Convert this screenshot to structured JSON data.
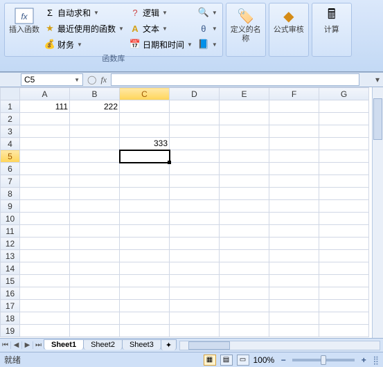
{
  "ribbon": {
    "group1_label": "函数库",
    "insert_fn": "插入函数",
    "autosum": "自动求和",
    "recent": "最近使用的函数",
    "financial": "财务",
    "logical": "逻辑",
    "text": "文本",
    "datetime": "日期和时间",
    "define_name": "定义的名称",
    "formula_audit": "公式审核",
    "calculate": "计算"
  },
  "namebox": "C5",
  "columns": [
    "A",
    "B",
    "C",
    "D",
    "E",
    "F",
    "G"
  ],
  "rows": [
    "1",
    "2",
    "3",
    "4",
    "5",
    "6",
    "7",
    "8",
    "9",
    "10",
    "11",
    "12",
    "13",
    "14",
    "15",
    "16",
    "17",
    "18",
    "19"
  ],
  "cells": {
    "A1": "111",
    "B1": "222",
    "C4": "333"
  },
  "active_cell": {
    "row": 5,
    "col": "C"
  },
  "sheets": [
    "Sheet1",
    "Sheet2",
    "Sheet3"
  ],
  "active_sheet": 0,
  "status_text": "就绪",
  "zoom": "100%"
}
